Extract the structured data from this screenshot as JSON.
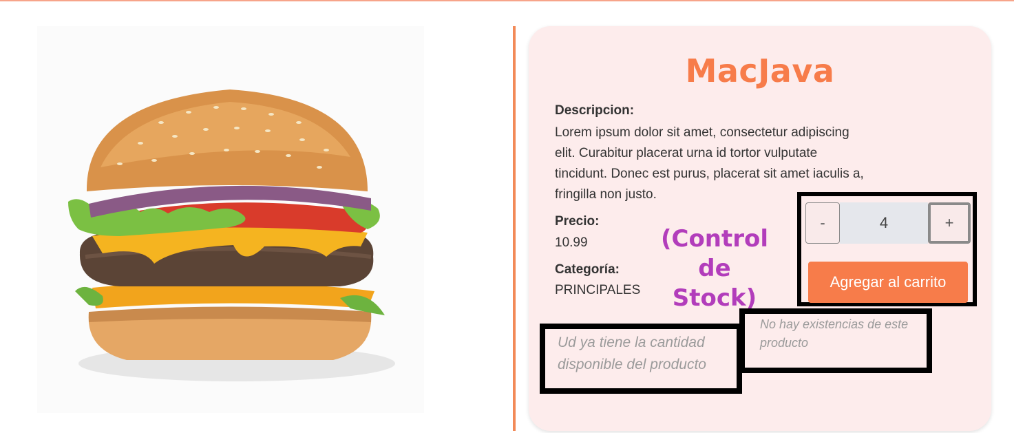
{
  "product": {
    "name": "MacJava",
    "description_label": "Descripcion:",
    "description": "Lorem ipsum dolor sit amet, consectetur adipiscing elit. Curabitur placerat urna id tortor vulputate tincidunt. Donec est purus, placerat sit amet iaculis a, fringilla non justo.",
    "price_label": "Precio:",
    "price": "10.99",
    "category_label": "Categoría:",
    "category": "PRINCIPALES",
    "image_icon": "burger-image"
  },
  "annotation": {
    "line1": "(Control de",
    "line2": "Stock)"
  },
  "stock_control": {
    "decrement_label": "-",
    "quantity": "4",
    "increment_label": "+",
    "add_to_cart_label": "Agregar al carrito"
  },
  "messages": {
    "max_quantity": "Ud ya tiene la cantidad disponible del producto",
    "out_of_stock": "No hay existencias de este producto"
  },
  "colors": {
    "accent": "#f77c4a",
    "card_background": "#fdecec",
    "annotation": "#b23dbb"
  }
}
